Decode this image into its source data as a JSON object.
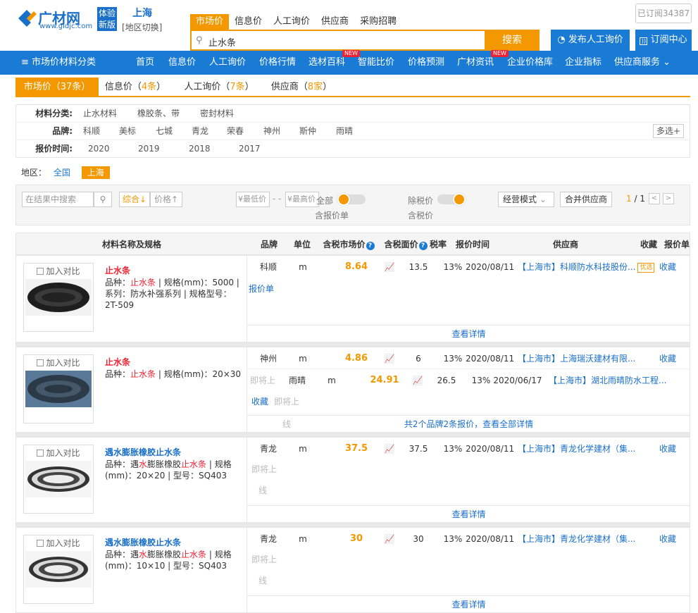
{
  "header": {
    "logo_text": "广材网",
    "logo_url": "www.gldjc.com",
    "logo_badge": "体验新版",
    "city": "上海",
    "region_switch": "[地区切换]",
    "subscribed": "已订阅34387",
    "search_tabs": [
      "市场价",
      "信息价",
      "人工询价",
      "供应商",
      "采购招聘"
    ],
    "search_value": "止水条",
    "search_button": "搜索",
    "publish_button": "发布人工询价",
    "subscribe_button": "订阅中心"
  },
  "nav": {
    "category": "≡ 市场价材料分类",
    "items": [
      "首页",
      "信息价",
      "人工询价",
      "价格行情",
      "选材百科",
      "智能比价",
      "价格预测",
      "广材资讯",
      "企业价格库",
      "企业指标",
      "供应商服务"
    ],
    "new_badge": "NEW"
  },
  "result_tabs": [
    {
      "label": "市场价（",
      "count": "37条",
      "suffix": "）"
    },
    {
      "label": "信息价（",
      "count": "4条",
      "suffix": "）"
    },
    {
      "label": "人工询价（",
      "count": "7条",
      "suffix": "）"
    },
    {
      "label": "供应商（",
      "count": "8家",
      "suffix": "）"
    }
  ],
  "filters": {
    "category_label": "材料分类:",
    "categories": [
      "止水材料",
      "橡胶条、带",
      "密封材料"
    ],
    "brand_label": "品牌:",
    "brands": [
      "科顺",
      "美标",
      "七城",
      "青龙",
      "荣春",
      "神州",
      "斯仲",
      "雨晴"
    ],
    "more": "多选+",
    "time_label": "报价时间:",
    "years": [
      "2020",
      "2019",
      "2018",
      "2017"
    ]
  },
  "region": {
    "label": "地区：",
    "all": "全国",
    "selected": "上海"
  },
  "toolbar": {
    "search_placeholder": "在结果中搜索",
    "sort": "综合↓",
    "price": "价格↑",
    "min": "¥最低价",
    "dash": "- -",
    "max": "¥最高价",
    "all_suffix": "全部",
    "tax_quote": "含报价单",
    "tax_free": "除税价",
    "tax_incl": "含税价",
    "mode": "经营模式",
    "merge": "合并供应商",
    "page_cur": "1",
    "page_total": "/ 1"
  },
  "table_header": {
    "name": "材料名称及规格",
    "brand": "品牌",
    "unit": "单位",
    "market_price": "含税市场价",
    "face_price": "含税面价",
    "tax": "税率",
    "time": "报价时间",
    "supplier": "供应商",
    "fav": "收藏",
    "quote": "报价单"
  },
  "products": [
    {
      "compare": "加入对比",
      "name": "止水条",
      "desc_pre": "品种：",
      "desc_hl": "止水条",
      "desc_post": " | 规格(mm)：5000 | 系列：防水补强系列 | 规格型号：2T-509",
      "rows": [
        {
          "brand": "科顺",
          "unit": "m",
          "price": "8.64",
          "face": "13.5",
          "tax": "13%",
          "date": "2020/08/11",
          "supplier": "【上海市】科顺防水科技股份...",
          "badge": "优选",
          "fav": "收藏"
        }
      ],
      "extra": "报价单",
      "detail": "查看详情"
    },
    {
      "compare": "加入对比",
      "name": "止水条",
      "desc_pre": "品种：",
      "desc_hl": "止水条",
      "desc_post": " | 规格(mm)：20×30",
      "rows": [
        {
          "brand": "神州",
          "unit": "m",
          "price": "4.86",
          "face": "6",
          "tax": "13%",
          "date": "2020/08/11",
          "supplier": "【上海市】上海瑞沃建材有限...",
          "fav": "收藏"
        },
        {
          "pre": "即将上",
          "brand": "雨晴",
          "unit": "m",
          "price": "24.91",
          "face": "26.5",
          "tax": "13%",
          "date": "2020/06/17",
          "supplier": "【上海市】湖北雨晴防水工程..."
        }
      ],
      "fav2": "收藏",
      "pending": "即将上",
      "line": "线",
      "detail": "共2个品牌2条报价，查看全部详情"
    },
    {
      "compare": "加入对比",
      "name": "遇水膨胀橡胶止水条",
      "desc_pre": "品种：遇",
      "desc_hl": "水",
      "desc_mid": "膨胀橡胶",
      "desc_hl2": "止水条",
      "desc_post": " | 规格(mm)：20×20 | 型号：SQ403",
      "rows": [
        {
          "brand": "青龙",
          "unit": "m",
          "price": "37.5",
          "face": "37.5",
          "tax": "13%",
          "date": "2020/08/11",
          "supplier": "【上海市】青龙化学建材（集...",
          "fav": "收藏"
        }
      ],
      "pending": "即将上",
      "line": "线",
      "detail": "查看详情"
    },
    {
      "compare": "加入对比",
      "name": "遇水膨胀橡胶止水条",
      "desc_pre": "品种：遇",
      "desc_hl": "水",
      "desc_mid": "膨胀橡胶",
      "desc_hl2": "止水条",
      "desc_post": " | 规格(mm)：10×10 | 型号：SQ403",
      "rows": [
        {
          "brand": "青龙",
          "unit": "m",
          "price": "30",
          "face": "30",
          "tax": "13%",
          "date": "2020/08/11",
          "supplier": "【上海市】青龙化学建材（集...",
          "fav": "收藏"
        }
      ],
      "pending": "即将上",
      "line": "线",
      "detail": "查看详情"
    }
  ],
  "colors": {
    "brand_blue": "#1a7bd5",
    "accent_orange": "#f39800",
    "highlight_red": "#e23"
  }
}
